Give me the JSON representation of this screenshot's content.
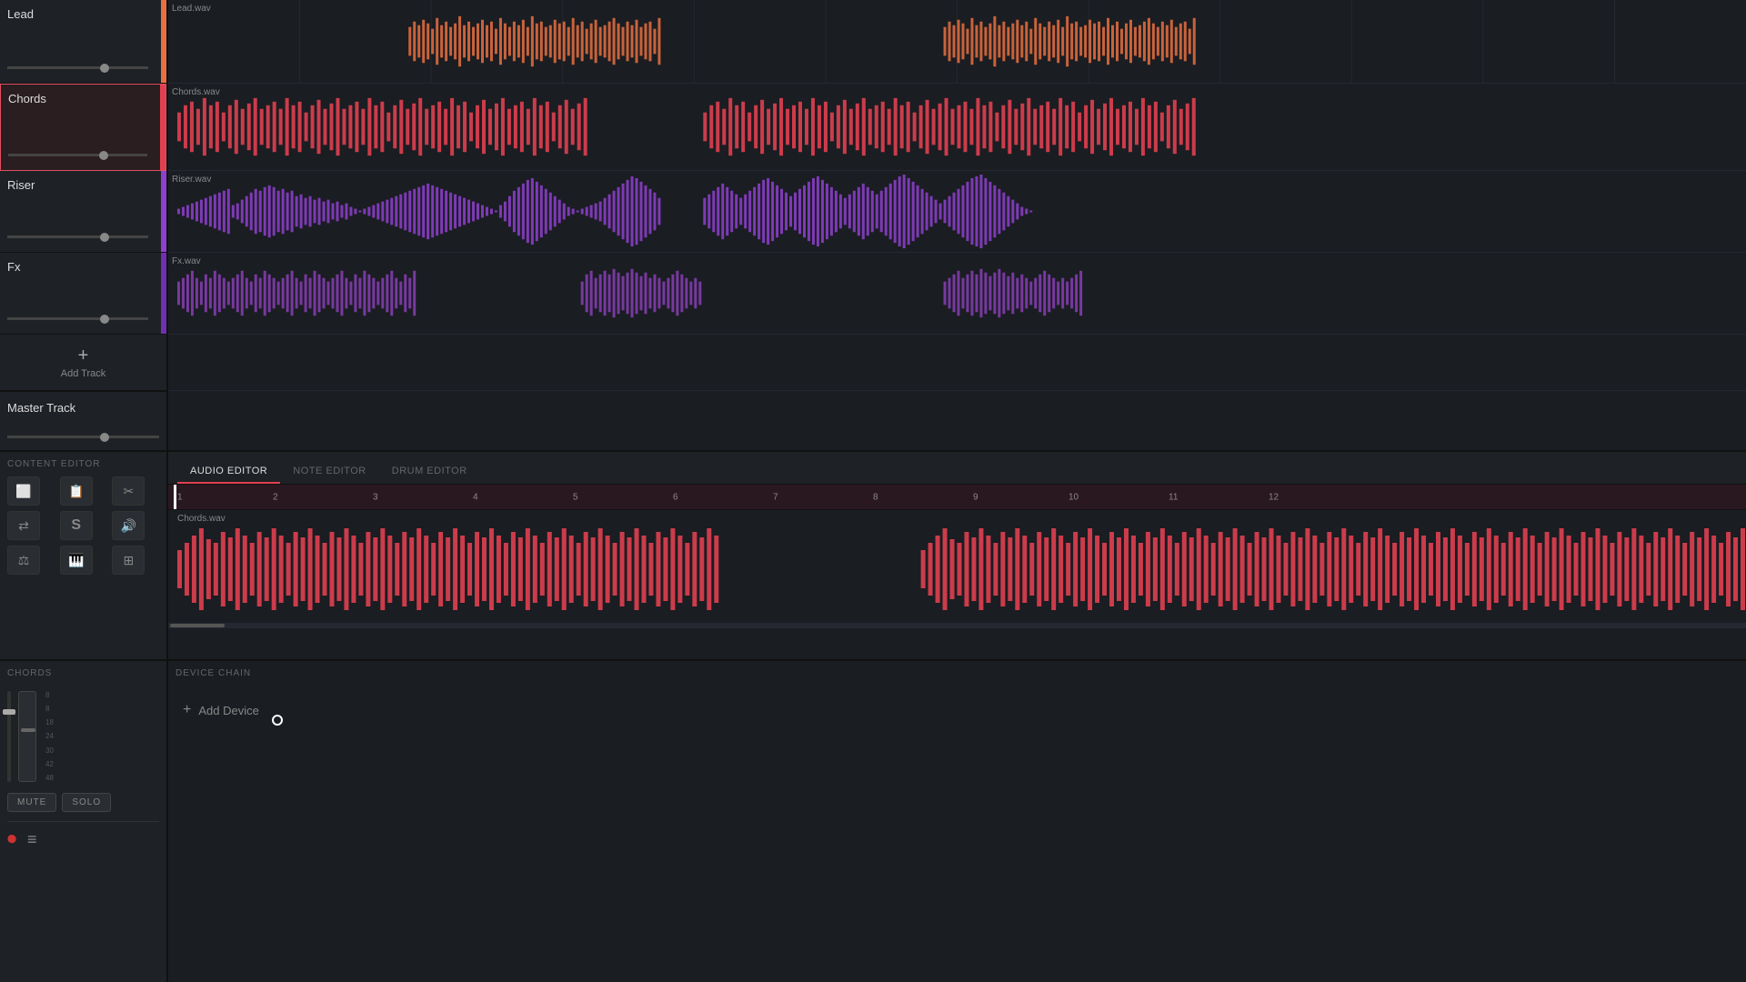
{
  "tracks": [
    {
      "id": "lead",
      "name": "Lead",
      "file": "Lead.wav",
      "color": "orange",
      "colorHex": "#e87040",
      "volume": 70
    },
    {
      "id": "chords",
      "name": "Chords",
      "file": "Chords.wav",
      "color": "red",
      "colorHex": "#e04050",
      "volume": 70,
      "selected": true
    },
    {
      "id": "riser",
      "name": "Riser",
      "file": "Riser.wav",
      "color": "purple",
      "colorHex": "#9040d0",
      "volume": 70
    },
    {
      "id": "fx",
      "name": "Fx",
      "file": "Fx.wav",
      "color": "purple2",
      "colorHex": "#7030b0",
      "volume": 70
    }
  ],
  "masterTrack": {
    "name": "Master Track",
    "volume": 65
  },
  "addTrack": {
    "label": "Add Track"
  },
  "editorTabs": [
    {
      "id": "audio",
      "label": "AUDIO EDITOR",
      "active": true
    },
    {
      "id": "note",
      "label": "NOTE EDITOR",
      "active": false
    },
    {
      "id": "drum",
      "label": "DRUM EDITOR",
      "active": false
    }
  ],
  "contentEditor": {
    "title": "CONTENT EDITOR"
  },
  "rulerMarks": [
    "2",
    "3",
    "4",
    "5",
    "6",
    "7",
    "8",
    "9",
    "10",
    "11",
    "12"
  ],
  "detailRulerMarks": [
    "2",
    "3",
    "4",
    "5",
    "6",
    "7",
    "8",
    "9",
    "10",
    "11",
    "12"
  ],
  "chordsSection": {
    "title": "CHORDS",
    "muteLabel": "MUTE",
    "soloLabel": "SOLO"
  },
  "deviceChain": {
    "title": "DEVICE CHAIN",
    "addDeviceLabel": "Add Device"
  },
  "dbScale": [
    "8",
    "8",
    "18",
    "24",
    "30",
    "42",
    "48"
  ]
}
